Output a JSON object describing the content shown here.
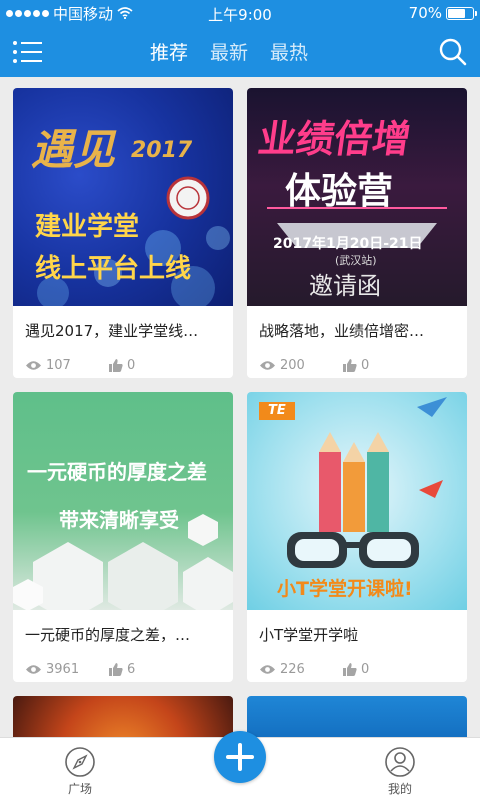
{
  "status_bar": {
    "carrier": "中国移动",
    "time": "上午9:00",
    "battery_percent": "70%",
    "battery_level": 0.7
  },
  "nav": {
    "tabs": [
      {
        "label": "推荐",
        "active": true
      },
      {
        "label": "最新",
        "active": false
      },
      {
        "label": "最热",
        "active": false
      }
    ],
    "menu_icon": "menu-icon",
    "search_icon": "search-icon"
  },
  "cards": [
    {
      "title": "遇见2017，建业学堂线…",
      "views": "107",
      "likes": "0",
      "art": {
        "line1": "遇见",
        "year": "2017",
        "line2": "建业学堂",
        "line3": "线上平台上线"
      }
    },
    {
      "title": "战略落地，业绩倍增密…",
      "views": "200",
      "likes": "0",
      "art": {
        "line1": "业绩倍增",
        "line2": "体验营",
        "date": "2017年1月20日-21日",
        "place": "(武汉站)",
        "invite": "邀请函"
      }
    },
    {
      "title": "一元硬币的厚度之差，…",
      "views": "3961",
      "likes": "6",
      "art": {
        "line1": "一元硬币的厚度之差",
        "line2": "带来清晰享受"
      }
    },
    {
      "title": "小T学堂开学啦",
      "views": "226",
      "likes": "0",
      "art": {
        "brand": "TE",
        "line1": "小T学堂开课啦!"
      }
    }
  ],
  "tabbar": {
    "items": [
      {
        "label": "广场",
        "icon": "compass-icon"
      },
      {
        "label": "我的",
        "icon": "user-icon"
      }
    ],
    "fab_icon": "plus-icon"
  },
  "colors": {
    "accent": "#1e8fe1",
    "background": "#ececec"
  }
}
